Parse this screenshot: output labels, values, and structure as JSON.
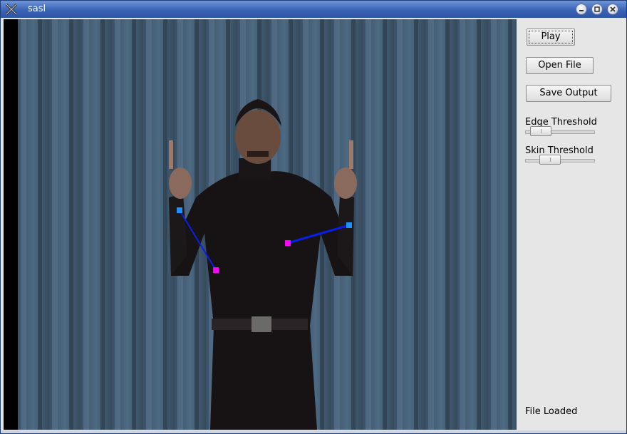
{
  "window": {
    "title": "sasl"
  },
  "controls": {
    "play_label": "Play",
    "open_label": "Open File",
    "save_label": "Save Output",
    "edge_label": "Edge Threshold",
    "skin_label": "Skin Threshold",
    "edge_value": 0.1,
    "skin_value": 0.3
  },
  "status": {
    "text": "File Loaded"
  },
  "icons": [
    "app-icon",
    "minimize-icon",
    "maximize-icon",
    "close-icon"
  ],
  "colors": {
    "tracker_line": "#0a1ee6",
    "tracker_point_a": "#1e90ff",
    "tracker_point_b": "#ff00ff"
  }
}
